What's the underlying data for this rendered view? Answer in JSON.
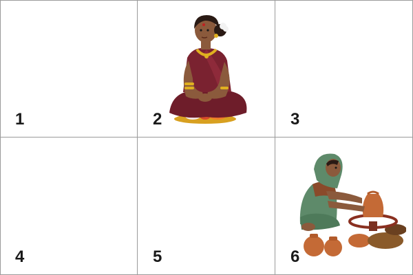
{
  "grid": {
    "cells": [
      {
        "label": "1",
        "image": null
      },
      {
        "label": "2",
        "image": "woman-seated-with-spice-plate"
      },
      {
        "label": "3",
        "image": null
      },
      {
        "label": "4",
        "image": null
      },
      {
        "label": "5",
        "image": null
      },
      {
        "label": "6",
        "image": "woman-potter-at-wheel"
      }
    ]
  },
  "colors": {
    "border": "#9a9a9a",
    "number": "#1a1a1a",
    "saree": "#7a2230",
    "skin": "#8b5a3c",
    "gold": "#e0b020",
    "clay": "#c46a36",
    "potter_saree": "#5e8a6a"
  }
}
